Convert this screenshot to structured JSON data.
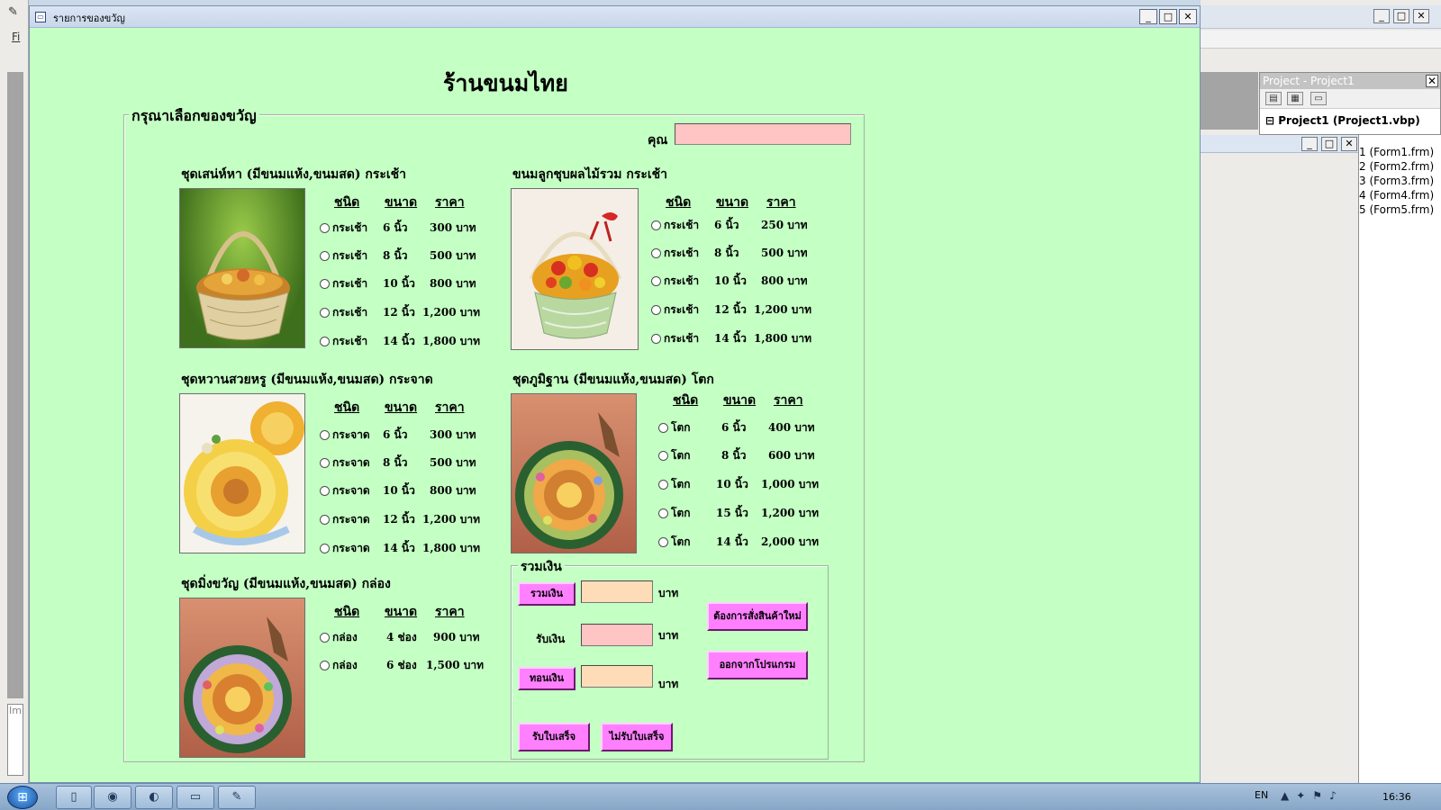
{
  "ide": {
    "menu_first_letter": "Fi",
    "immediate_label": "Imi",
    "project_panel_title": "Project - Project1",
    "project_root": "Project1 (Project1.vbp)",
    "form_files": [
      "1 (Form1.frm)",
      "2 (Form2.frm)",
      "3 (Form3.frm)",
      "4 (Form4.frm)",
      "5 (Form5.frm)"
    ]
  },
  "window": {
    "title": "รายการของขวัญ"
  },
  "shop_title": "ร้านขนมไทย",
  "gift_frame_label": "กรุณาเลือกของขวัญ",
  "customer_label": "คุณ",
  "customer_value": "",
  "column_headers": {
    "type": "ชนิด",
    "size": "ขนาด",
    "price": "ราคา"
  },
  "sets": [
    {
      "title": "ชุดเสน่ห์หา (มีขนมแห้ง,ขนมสด) กระเช้า",
      "options": [
        {
          "type": "กระเช้า",
          "size": "6 นิ้ว",
          "price": "300 บาท"
        },
        {
          "type": "กระเช้า",
          "size": "8 นิ้ว",
          "price": "500 บาท"
        },
        {
          "type": "กระเช้า",
          "size": "10 นิ้ว",
          "price": "800 บาท"
        },
        {
          "type": "กระเช้า",
          "size": "12 นิ้ว",
          "price": "1,200 บาท"
        },
        {
          "type": "กระเช้า",
          "size": "14 นิ้ว",
          "price": "1,800 บาท"
        }
      ]
    },
    {
      "title": "ขนมลูกชุบผลไม้รวม กระเช้า",
      "options": [
        {
          "type": "กระเช้า",
          "size": "6 นิ้ว",
          "price": "250 บาท"
        },
        {
          "type": "กระเช้า",
          "size": "8 นิ้ว",
          "price": "500 บาท"
        },
        {
          "type": "กระเช้า",
          "size": "10 นิ้ว",
          "price": "800 บาท"
        },
        {
          "type": "กระเช้า",
          "size": "12 นิ้ว",
          "price": "1,200 บาท"
        },
        {
          "type": "กระเช้า",
          "size": "14 นิ้ว",
          "price": "1,800 บาท"
        }
      ]
    },
    {
      "title": "ชุดหวานสวยหรู (มีขนมแห้ง,ขนมสด) กระจาด",
      "options": [
        {
          "type": "กระจาด",
          "size": "6 นิ้ว",
          "price": "300 บาท"
        },
        {
          "type": "กระจาด",
          "size": "8 นิ้ว",
          "price": "500 บาท"
        },
        {
          "type": "กระจาด",
          "size": "10 นิ้ว",
          "price": "800 บาท"
        },
        {
          "type": "กระจาด",
          "size": "12 นิ้ว",
          "price": "1,200 บาท"
        },
        {
          "type": "กระจาด",
          "size": "14 นิ้ว",
          "price": "1,800 บาท"
        }
      ]
    },
    {
      "title": "ชุดภูมิฐาน (มีขนมแห้ง,ขนมสด) โตก",
      "options": [
        {
          "type": "โตก",
          "size": "6 นิ้ว",
          "price": "400 บาท"
        },
        {
          "type": "โตก",
          "size": "8 นิ้ว",
          "price": "600 บาท"
        },
        {
          "type": "โตก",
          "size": "10 นิ้ว",
          "price": "1,000 บาท"
        },
        {
          "type": "โตก",
          "size": "15 นิ้ว",
          "price": "1,200 บาท"
        },
        {
          "type": "โตก",
          "size": "14 นิ้ว",
          "price": "2,000 บาท"
        }
      ]
    },
    {
      "title": "ชุดมิ่งขวัญ (มีขนมแห้ง,ขนมสด) กล่อง",
      "options": [
        {
          "type": "กล่อง",
          "size": "4 ช่อง",
          "price": "900 บาท"
        },
        {
          "type": "กล่อง",
          "size": "6 ช่อง",
          "price": "1,500 บาท"
        }
      ]
    }
  ],
  "totals": {
    "frame_label": "รวมเงิน",
    "sum_button": "รวมเงิน",
    "received_label": "รับเงิน",
    "change_button": "ทอนเงิน",
    "baht": "บาท",
    "sum_value": "",
    "received_value": "",
    "change_value": "",
    "receipt_button": "รับใบเสร็จ",
    "no_receipt_button": "ไม่รับใบเสร็จ",
    "new_order_button": "ต้องการสั่งสินค้าใหม่",
    "exit_button": "ออกจากโปรแกรม"
  },
  "taskbar": {
    "language": "EN",
    "clock": "16:36"
  },
  "colors": {
    "form_bg": "#c4ffc4",
    "button_pink": "#ff80ff",
    "input_pink": "#ffc4c4",
    "input_peach": "#ffdcb8"
  }
}
